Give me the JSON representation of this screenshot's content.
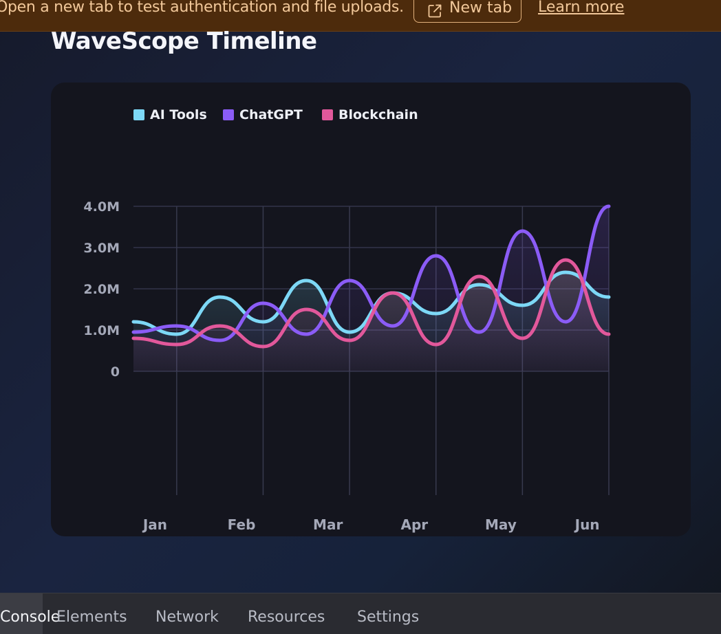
{
  "banner": {
    "text": "Open a new tab to test authentication and file uploads.",
    "new_tab_label": "New tab",
    "learn_more_label": "Learn more",
    "icon": "external-link-icon"
  },
  "page": {
    "title": "WaveScope Timeline"
  },
  "chart_data": {
    "type": "line",
    "title": "",
    "xlabel": "",
    "ylabel": "",
    "categories": [
      "Jan",
      "Feb",
      "Mar",
      "Apr",
      "May",
      "Jun"
    ],
    "y_ticks": [
      "4.0M",
      "3.0M",
      "2.0M",
      "1.0M",
      "0"
    ],
    "ylim": [
      0,
      4000000
    ],
    "x_range": [
      0,
      5.5
    ],
    "grid": true,
    "legend_position": "top-left",
    "area_fill": true,
    "smooth": true,
    "series": [
      {
        "name": "AI Tools",
        "color": "#7dd8f6",
        "x": [
          0,
          0.5,
          1,
          1.5,
          2,
          2.5,
          3,
          3.5,
          4,
          4.5,
          5,
          5.5
        ],
        "values": [
          1200000,
          900000,
          1800000,
          1200000,
          2200000,
          950000,
          1900000,
          1400000,
          2100000,
          1600000,
          2400000,
          1800000
        ]
      },
      {
        "name": "ChatGPT",
        "color": "#8b5cf6",
        "x": [
          0,
          0.5,
          1,
          1.5,
          2,
          2.5,
          3,
          3.5,
          4,
          4.5,
          5,
          5.5
        ],
        "values": [
          950000,
          1100000,
          750000,
          1650000,
          900000,
          2200000,
          1100000,
          2800000,
          950000,
          3400000,
          1200000,
          4000000
        ]
      },
      {
        "name": "Blockchain",
        "color": "#e2589b",
        "x": [
          0,
          0.5,
          1,
          1.5,
          2,
          2.5,
          3,
          3.5,
          4,
          4.5,
          5,
          5.5
        ],
        "values": [
          800000,
          650000,
          1100000,
          600000,
          1500000,
          750000,
          1900000,
          650000,
          2300000,
          800000,
          2700000,
          900000
        ]
      }
    ]
  },
  "devtools": {
    "tabs": [
      "Console",
      "Elements",
      "Network",
      "Resources",
      "Settings"
    ],
    "active_tab": "Console"
  }
}
